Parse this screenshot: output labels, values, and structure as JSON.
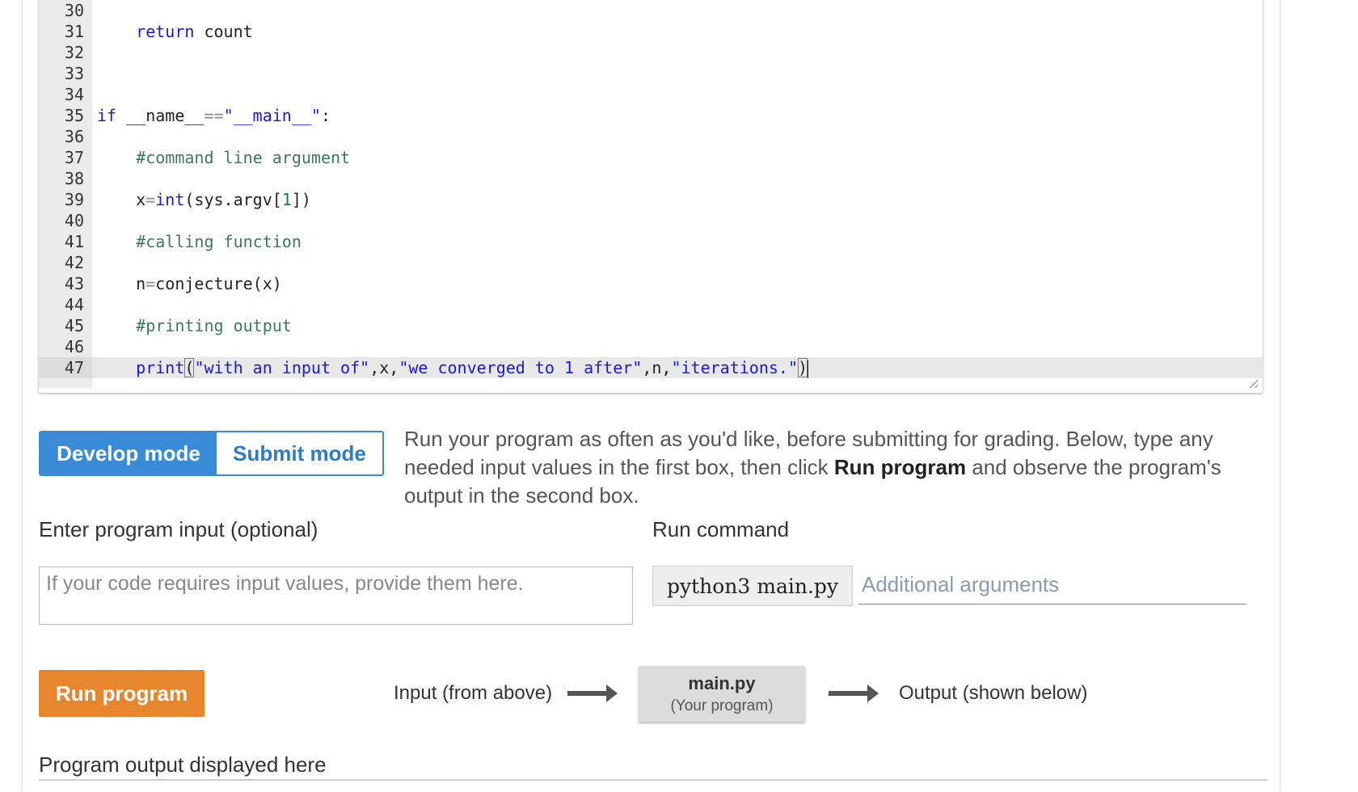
{
  "editor": {
    "lines": [
      {
        "num": "30",
        "html": ""
      },
      {
        "num": "31",
        "html": "    <span class=\"kw\">return</span> count"
      },
      {
        "num": "32",
        "html": ""
      },
      {
        "num": "33",
        "html": ""
      },
      {
        "num": "34",
        "html": ""
      },
      {
        "num": "35",
        "html": "<span class=\"kw\">if</span> __name__<span class=\"op\">==</span><span class=\"str\">\"__main__\"</span>:"
      },
      {
        "num": "36",
        "html": ""
      },
      {
        "num": "37",
        "html": "    <span class=\"cm\">#command line argument</span>"
      },
      {
        "num": "38",
        "html": ""
      },
      {
        "num": "39",
        "html": "    x<span class=\"op\">=</span><span class=\"kw\">int</span>(sys.argv[<span class=\"num\">1</span>])"
      },
      {
        "num": "40",
        "html": ""
      },
      {
        "num": "41",
        "html": "    <span class=\"cm\">#calling function</span>"
      },
      {
        "num": "42",
        "html": ""
      },
      {
        "num": "43",
        "html": "    n<span class=\"op\">=</span>conjecture(x)"
      },
      {
        "num": "44",
        "html": ""
      },
      {
        "num": "45",
        "html": "    <span class=\"cm\">#printing output</span>"
      },
      {
        "num": "46",
        "html": ""
      },
      {
        "num": "47",
        "html": "    <span class=\"kw\">print</span><span class=\"cursor-bracket\">(</span><span class=\"str\">\"with an input of\"</span>,x,<span class=\"str\">\"we converged to 1 after\"</span>,n,<span class=\"str\">\"iterations.\"</span><span class=\"cursor-bracket\">)</span><span class=\"caret\"></span>",
        "active": true
      }
    ]
  },
  "modes": {
    "develop": "Develop mode",
    "submit": "Submit mode"
  },
  "instructions": {
    "part1": "Run your program as often as you'd like, before submitting for grading. Below, type any needed input values in the first box, then click ",
    "bold": "Run program",
    "part2": " and observe the program's output in the second box."
  },
  "input_section": {
    "label": "Enter program input (optional)",
    "placeholder": "If your code requires input values, provide them here."
  },
  "run_command": {
    "label": "Run command",
    "command": "python3 main.py",
    "args_placeholder": "Additional arguments"
  },
  "run_button": "Run program",
  "flow": {
    "input": "Input (from above)",
    "program_name": "main.py",
    "program_sub": "(Your program)",
    "output": "Output (shown below)"
  },
  "output_section": {
    "label": "Program output displayed here"
  }
}
